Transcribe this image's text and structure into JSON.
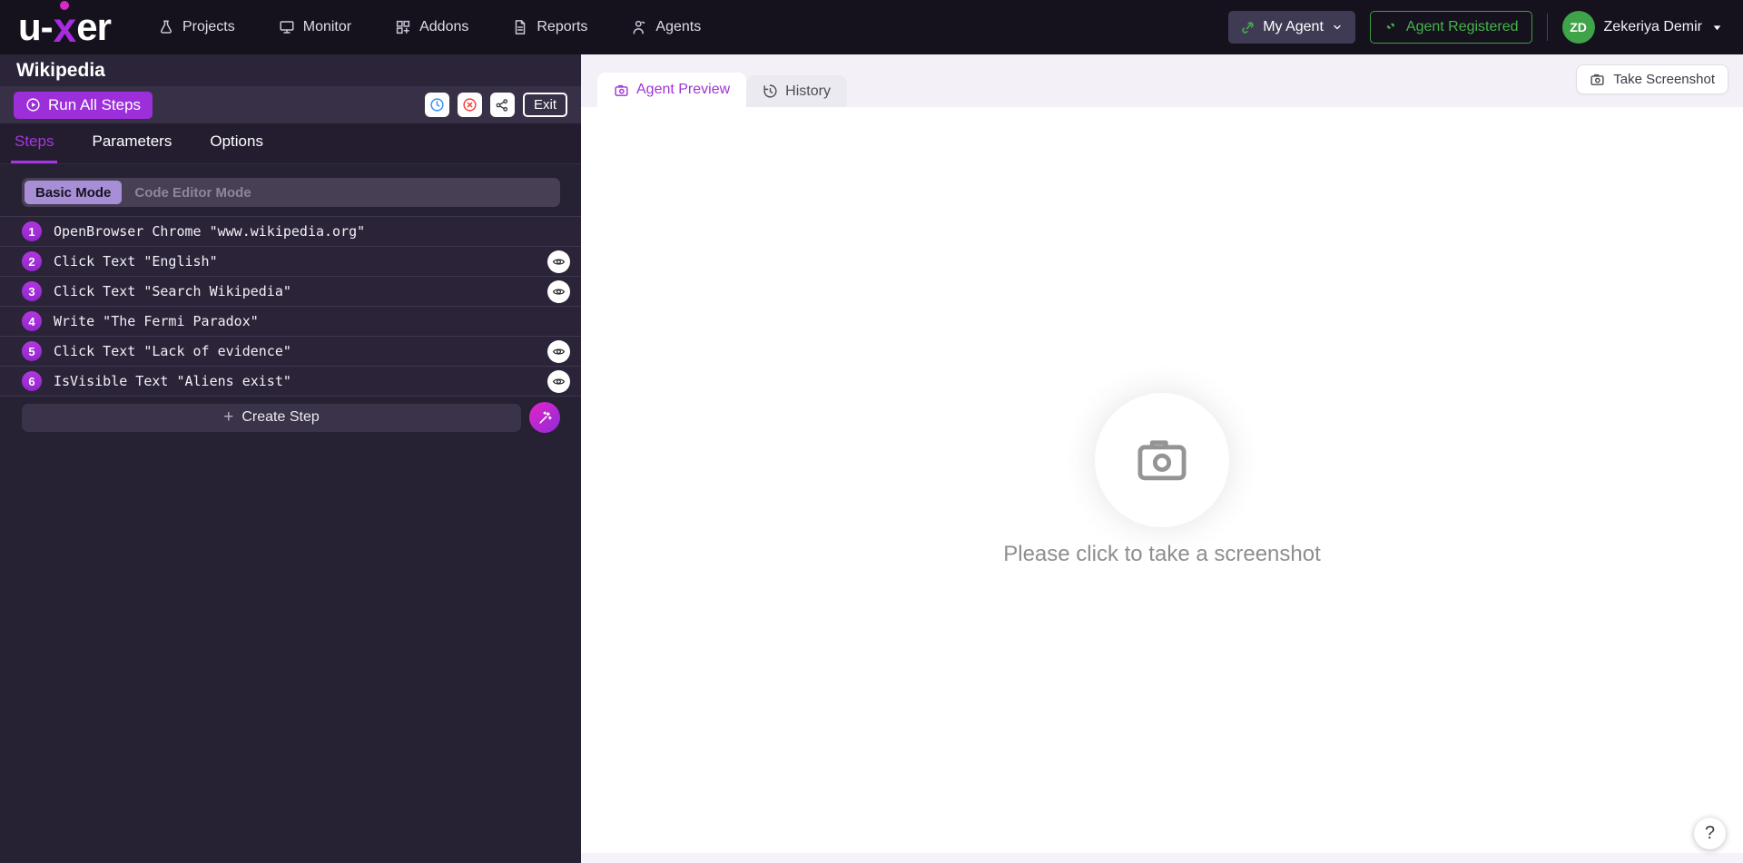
{
  "navbar": {
    "logo": {
      "part1": "u-",
      "part2": "x",
      "part3": "er"
    },
    "items": [
      {
        "label": "Projects",
        "icon": "flask-icon"
      },
      {
        "label": "Monitor",
        "icon": "monitor-icon"
      },
      {
        "label": "Addons",
        "icon": "addons-grid-icon"
      },
      {
        "label": "Reports",
        "icon": "report-file-icon"
      },
      {
        "label": "Agents",
        "icon": "agent-person-icon"
      }
    ],
    "my_agent_label": "My Agent",
    "agent_registered_label": "Agent Registered",
    "user": {
      "initials": "ZD",
      "name": "Zekeriya Demir"
    }
  },
  "panel": {
    "title": "Wikipedia",
    "run_all_label": "Run All Steps",
    "exit_label": "Exit",
    "tabs": [
      {
        "label": "Steps"
      },
      {
        "label": "Parameters"
      },
      {
        "label": "Options"
      }
    ],
    "mode_toggle": {
      "basic_label": "Basic Mode",
      "code_label": "Code Editor Mode"
    },
    "steps": [
      {
        "num": "1",
        "text": "OpenBrowser Chrome \"www.wikipedia.org\"",
        "has_eye": false
      },
      {
        "num": "2",
        "text": "Click Text \"English\"",
        "has_eye": true
      },
      {
        "num": "3",
        "text": "Click Text \"Search Wikipedia\"",
        "has_eye": true
      },
      {
        "num": "4",
        "text": "Write \"The Fermi Paradox\"",
        "has_eye": false
      },
      {
        "num": "5",
        "text": "Click Text \"Lack of evidence\"",
        "has_eye": true
      },
      {
        "num": "6",
        "text": "IsVisible Text \"Aliens exist\"",
        "has_eye": true
      }
    ],
    "create_step_label": "Create Step",
    "create_step_plus": "+"
  },
  "preview": {
    "tabs": [
      {
        "label": "Agent Preview"
      },
      {
        "label": "History"
      }
    ],
    "take_screenshot_label": "Take Screenshot",
    "empty_text": "Please click to take a screenshot",
    "help_label": "?"
  },
  "icons": {
    "run_play": "play-circle-icon",
    "schedule": "clock-icon",
    "stop": "stop-circle-x-icon",
    "share": "share-nodes-icon",
    "eye": "eye-icon",
    "wand": "magic-wand-icon",
    "camera": "camera-icon",
    "history": "history-clock-icon",
    "link": "link-icon",
    "plug": "plug-link-icon",
    "chevron": "chevron-down-icon",
    "caret": "caret-down-icon"
  },
  "colors": {
    "accent_purple": "#9c2fd9",
    "tab_active_purple": "#a133d6",
    "logo_magenta": "#a92be0",
    "green": "#43a047",
    "blue": "#2e8ff2",
    "red": "#f23b3b",
    "navbar_bg": "#15121e",
    "panel_bg": "#272134",
    "preview_bg": "#f5f3f9"
  }
}
